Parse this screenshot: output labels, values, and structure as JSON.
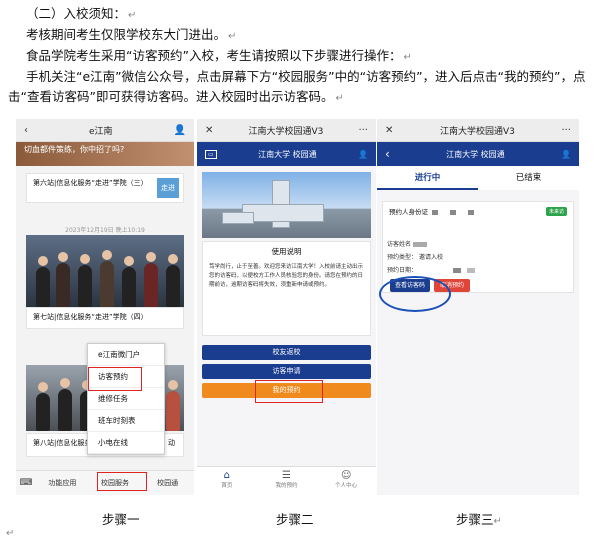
{
  "text": {
    "p1": "（二）入校须知：",
    "p2": "考核期间考生仅限学校东大门进出。",
    "p3": "食品学院考生采用“访客预约”入校，考生请按照以下步骤进行操作：",
    "p4": "手机关注“e江南”微信公众号，点击屏幕下方“校园服务”中的“访客预约”，进入后点击“我的预约”，点击“查看访客码”即可获得访客码。进入校园时出示访客码。",
    "mark": "↵"
  },
  "step1": {
    "title": "e江南",
    "banner": "切血都件策练，你中招了吗?",
    "card1": "第六站|信息化服务“走进”学院（三）",
    "card1_side": "走进",
    "date": "2023年12月19日 晚上10:19",
    "card2": "第七站|信息化服务“走进”学院（四）",
    "card3": "第八站|信息化服务“走进”学院",
    "card3_tail": "动",
    "menu": [
      "e江南微门户",
      "访客预约",
      "维修任务",
      "班车时刻表",
      "小电在线"
    ],
    "bottom": [
      "功能应用",
      "校园服务",
      "校园通"
    ]
  },
  "step2": {
    "title": "江南大学校园通V3",
    "logo": "江南大学 校园通",
    "notice_title": "使用说明",
    "notice_body": "笃学尚行，止于至善。欢迎您来访江南大学！入校前请主动出示您的访客码，以便校方工作人员核验您的身份。请您在预约的日期前访，逾期访客码将失效，须重新申请或预约。",
    "buttons": [
      "校友返校",
      "访客申请",
      "我的预约"
    ],
    "tabs": [
      "首页",
      "我的预约",
      "个人中心"
    ]
  },
  "step3": {
    "title": "江南大学校园通V3",
    "logo": "江南大学 校园通",
    "tabs": [
      "进行中",
      "已结束"
    ],
    "id_label": "预约人身份证",
    "status": "未来访",
    "visitor_label": "访客姓名",
    "type_label": "预约类型：",
    "type_value": "邀请入校",
    "time_label": "预约日期：",
    "view_btn": "查看访客码",
    "cancel_btn": "取消预约"
  },
  "captions": [
    "步骤一",
    "步骤二",
    "步骤三"
  ],
  "colors": {
    "nav_blue": "#1a3d8f",
    "orange": "#f08a1c",
    "red_box": "#e02424",
    "green": "#2ca24a"
  }
}
